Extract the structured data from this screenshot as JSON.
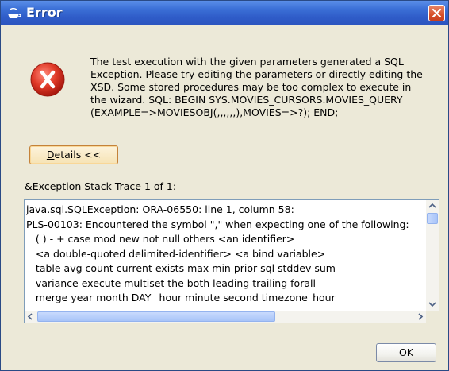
{
  "window": {
    "title": "Error"
  },
  "icons": {
    "title_icon": "coffee-cup-icon",
    "error_icon": "error-x-icon",
    "close_icon": "close-icon"
  },
  "colors": {
    "titlebar": "#2f5cc8",
    "close_button": "#d7502a",
    "error_red": "#d92b1f",
    "dialog_background": "#ece9d8",
    "button_highlight": "#c4823a"
  },
  "message": {
    "lines": [
      "The test execution with the given parameters generated a SQL",
      "Exception.  Please try editing the parameters or directly editing the",
      "XSD.  Some stored procedures may be too complex to execute in",
      "the wizard.  SQL: BEGIN SYS.MOVIES_CURSORS.MOVIES_QUERY",
      "(EXAMPLE=>MOVIESOBJ(,,,,,,),MOVIES=>?); END;"
    ]
  },
  "details_button": {
    "mnemonic": "D",
    "label_rest": "etails <<"
  },
  "trace": {
    "label": "&Exception Stack Trace 1 of 1:",
    "lines": [
      "java.sql.SQLException: ORA-06550: line 1, column 58:",
      "PLS-00103: Encountered the symbol \",\" when expecting one of the following:",
      "",
      "   ( ) - + case mod new not null others <an identifier>",
      "   <a double-quoted delimited-identifier> <a bind variable>",
      "   table avg count current exists max min prior sql stddev sum",
      "   variance execute multiset the both leading trailing forall",
      "   merge year month DAY_ hour minute second timezone_hour"
    ]
  },
  "ok_button": {
    "label": "OK"
  }
}
